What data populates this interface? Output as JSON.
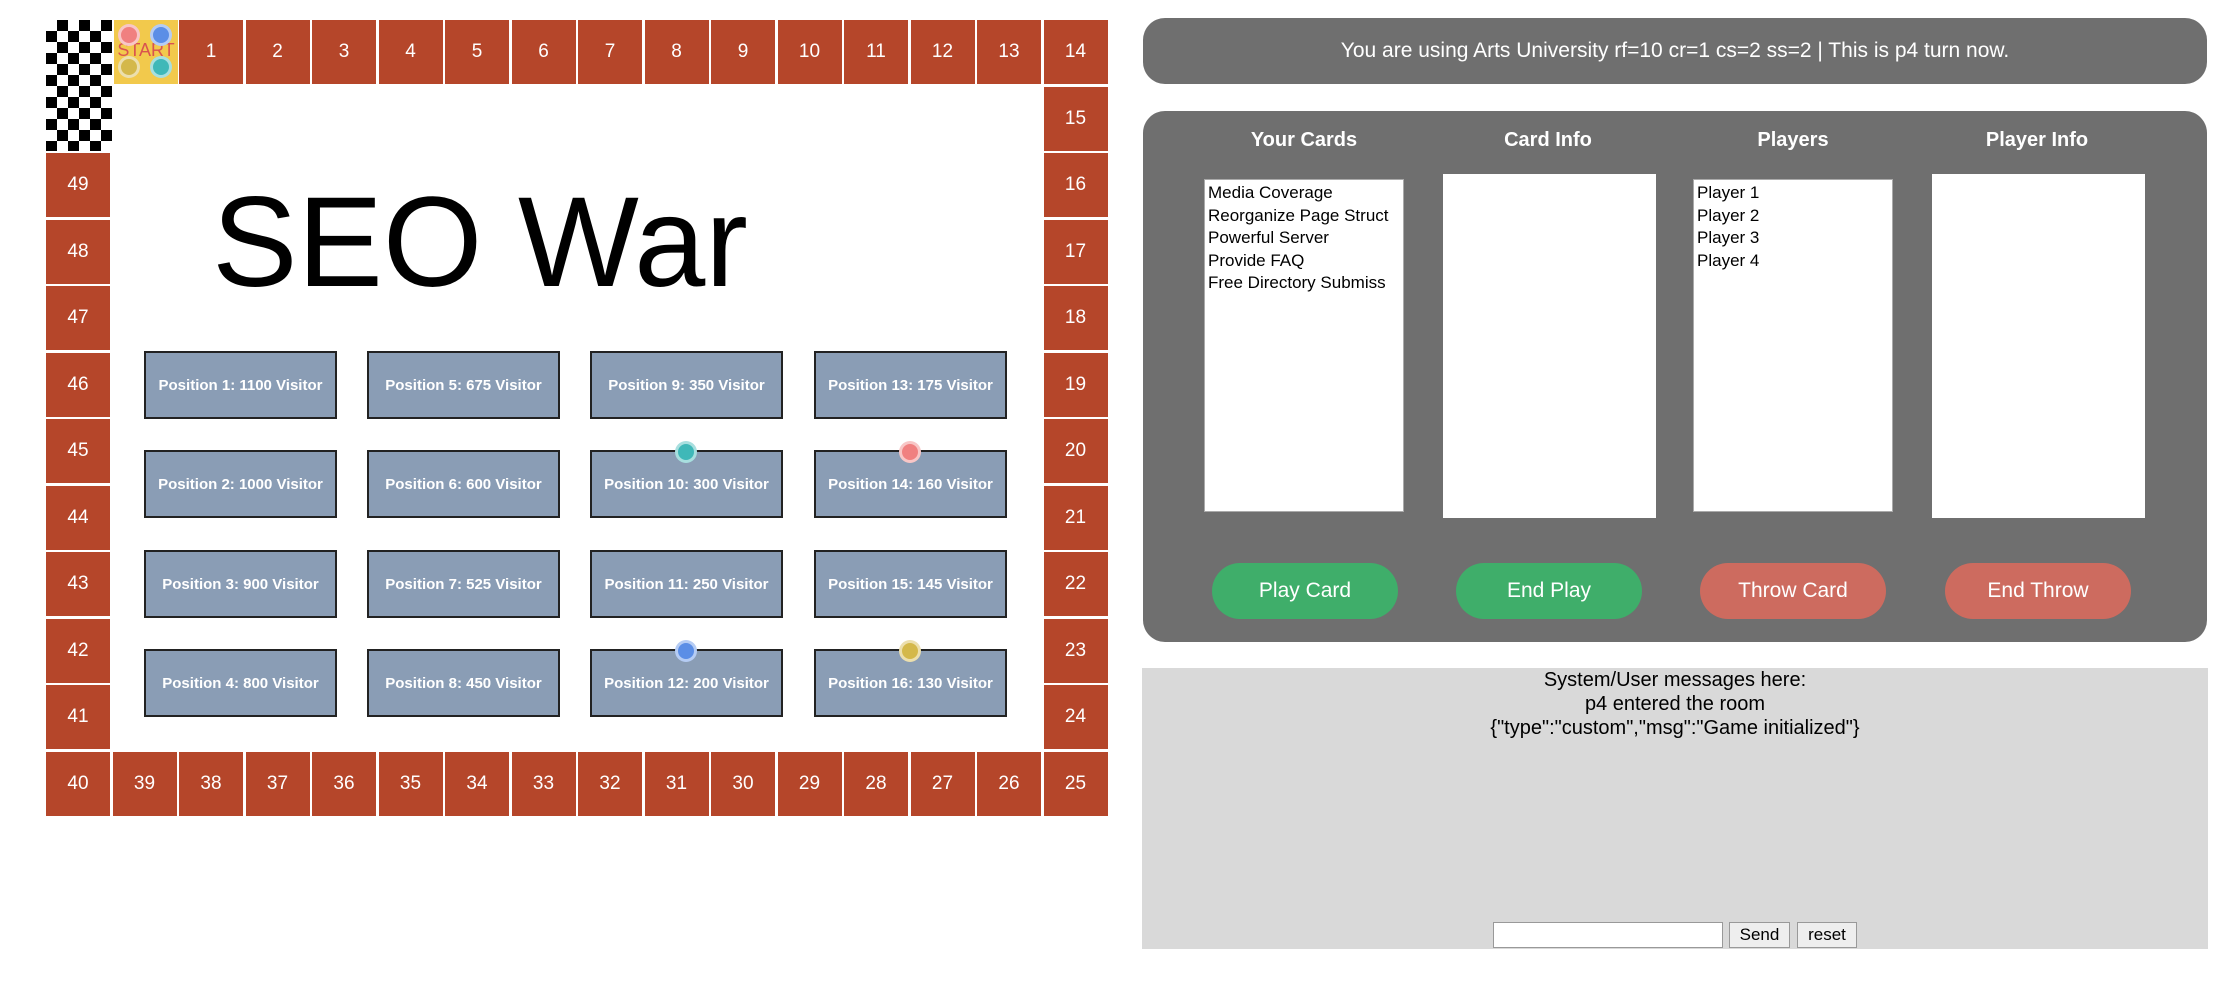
{
  "board": {
    "top_cells": [
      "1",
      "2",
      "3",
      "4",
      "5",
      "6",
      "7",
      "8",
      "9",
      "10",
      "11",
      "12",
      "13",
      "14"
    ],
    "right_cells": [
      "15",
      "16",
      "17",
      "18",
      "19",
      "20",
      "21",
      "22",
      "23",
      "24"
    ],
    "bottom_cells": [
      "40",
      "39",
      "38",
      "37",
      "36",
      "35",
      "34",
      "33",
      "32",
      "31",
      "30",
      "29",
      "28",
      "27",
      "26",
      "25"
    ],
    "left_cells": [
      "49",
      "48",
      "47",
      "46",
      "45",
      "44",
      "43",
      "42",
      "41"
    ],
    "start_label": "START",
    "title": "SEO War",
    "positions": [
      "Position 1: 1100 Visitor",
      "Position 2: 1000 Visitor",
      "Position 3: 900 Visitor",
      "Position 4: 800 Visitor",
      "Position 5: 675 Visitor",
      "Position 6: 600 Visitor",
      "Position 7: 525 Visitor",
      "Position 8: 450 Visitor",
      "Position 9: 350 Visitor",
      "Position 10: 300 Visitor",
      "Position 11: 250 Visitor",
      "Position 12: 200 Visitor",
      "Position 13: 175 Visitor",
      "Position 14: 160 Visitor",
      "Position 15: 145 Visitor",
      "Position 16: 130 Visitor"
    ],
    "colors": {
      "cell": "#b5462a",
      "position_box": "#8a9db5",
      "start": "#f2c94c"
    },
    "tokens": [
      {
        "player": "p1",
        "color": "#f08080",
        "location": "Position 14"
      },
      {
        "player": "p2",
        "color": "#5b8ee6",
        "location": "Position 12"
      },
      {
        "player": "p3",
        "color": "#d4b84a",
        "location": "Position 16"
      },
      {
        "player": "p4",
        "color": "#3fb8b8",
        "location": "Position 10"
      }
    ]
  },
  "status": "You are using Arts University rf=10 cr=1 cs=2 ss=2 | This is p4 turn now.",
  "panel": {
    "your_cards_title": "Your Cards",
    "card_info_title": "Card Info",
    "players_title": "Players",
    "player_info_title": "Player Info",
    "cards": [
      "Media Coverage",
      "Reorganize Page Struct",
      "Powerful Server",
      "Provide FAQ",
      "Free Directory Submiss"
    ],
    "players": [
      "Player 1",
      "Player 2",
      "Player 3",
      "Player 4"
    ],
    "buttons": {
      "play_card": "Play Card",
      "end_play": "End Play",
      "throw_card": "Throw Card",
      "end_throw": "End Throw"
    },
    "colors": {
      "green": "#3fae6a",
      "red": "#cd6b5f",
      "panel": "#6f6f6f"
    }
  },
  "messages": {
    "lines": [
      "System/User messages here:",
      "p4 entered the room",
      "{\"type\":\"custom\",\"msg\":\"Game initialized\"}"
    ],
    "input_value": "",
    "send_label": "Send",
    "reset_label": "reset"
  }
}
